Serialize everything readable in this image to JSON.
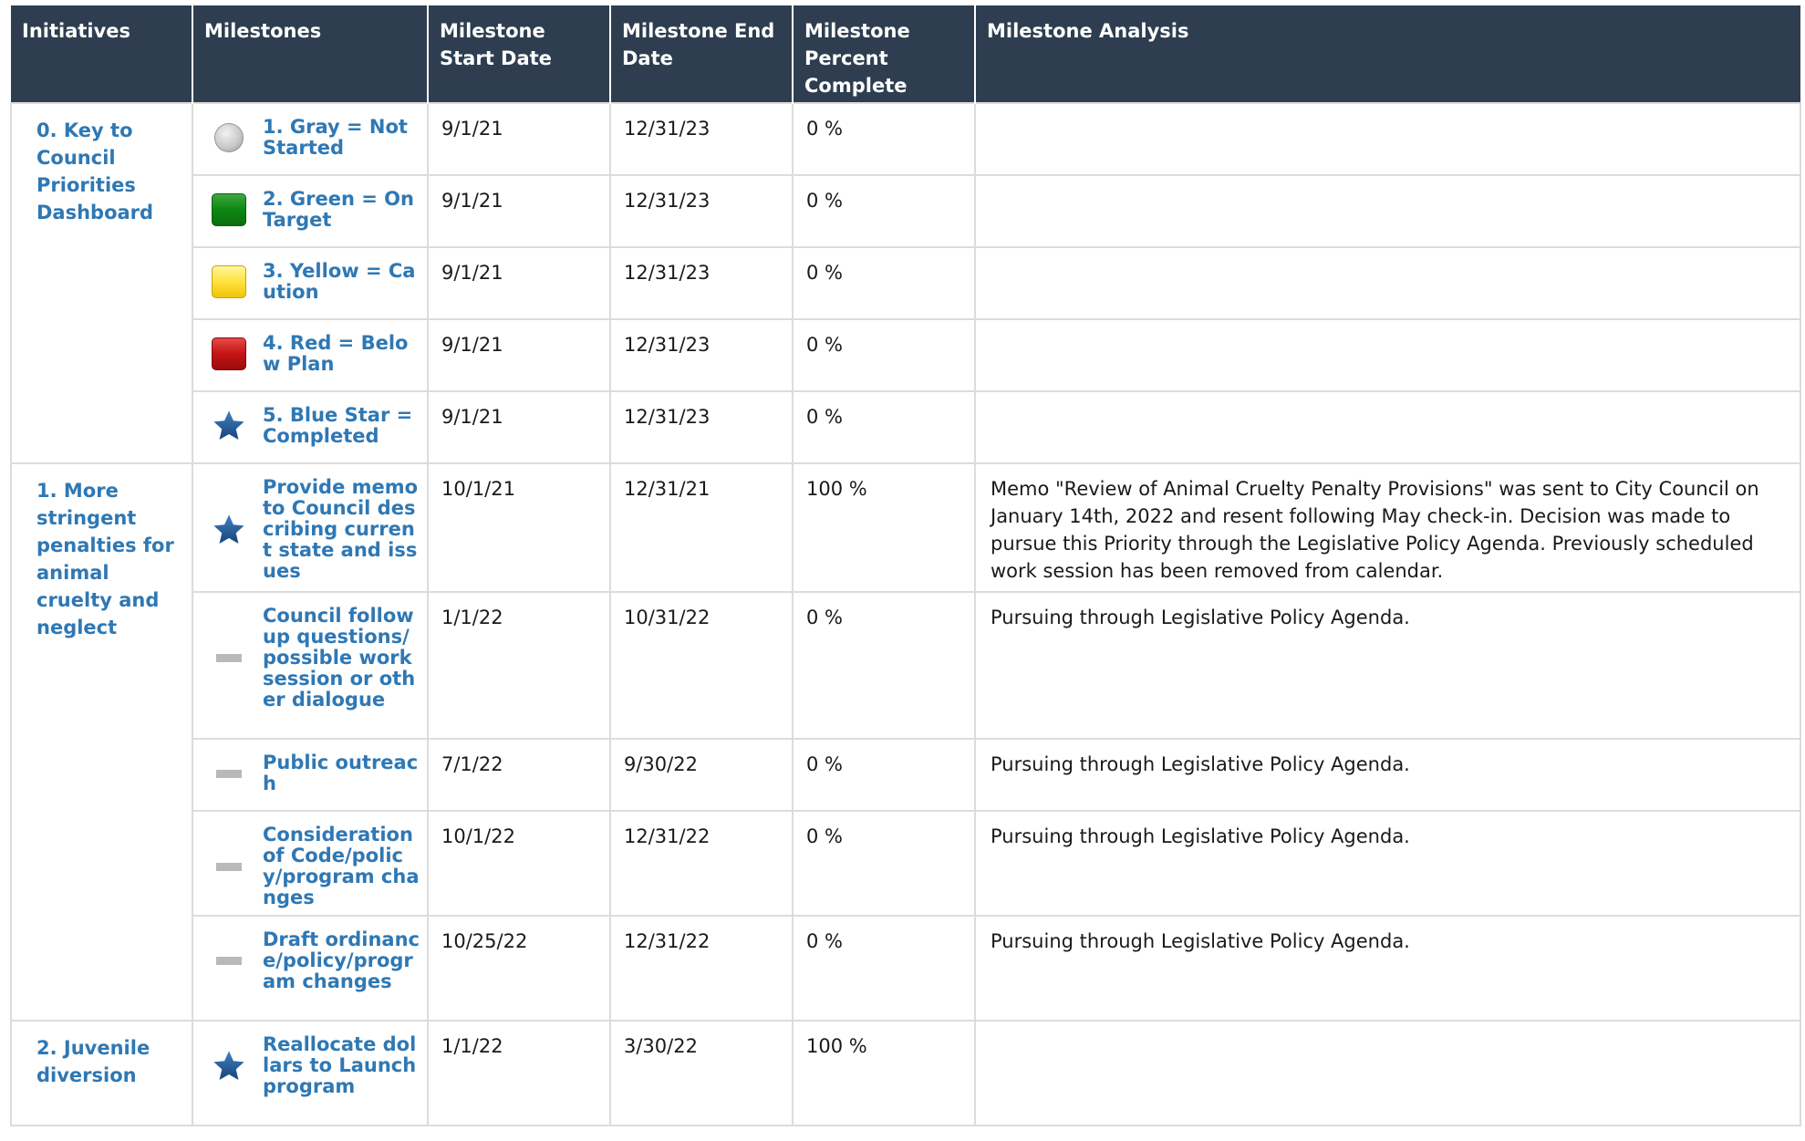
{
  "columns": {
    "initiatives": "Initiatives",
    "milestones": "Milestones",
    "start_date": "Milestone Start Date",
    "end_date": "Milestone End Date",
    "percent": "Milestone Percent Complete",
    "analysis": "Milestone Analysis"
  },
  "status_colors": {
    "link": "#2f78b4",
    "header_bg": "#2e3e50",
    "star": "#1f5d9e"
  },
  "groups": [
    {
      "initiative": "0. Key to Council Priorities Dashboard",
      "rows": [
        {
          "icon": "gray-circle-icon",
          "milestone": "1. Gray = Not Started",
          "start": "9/1/21",
          "end": "12/31/23",
          "percent": "0 %",
          "analysis": ""
        },
        {
          "icon": "green-square-icon",
          "milestone": "2. Green = On Target",
          "start": "9/1/21",
          "end": "12/31/23",
          "percent": "0 %",
          "analysis": ""
        },
        {
          "icon": "yellow-square-icon",
          "milestone": "3. Yellow = Caution",
          "start": "9/1/21",
          "end": "12/31/23",
          "percent": "0 %",
          "analysis": ""
        },
        {
          "icon": "red-square-icon",
          "milestone": "4. Red = Below Plan",
          "start": "9/1/21",
          "end": "12/31/23",
          "percent": "0 %",
          "analysis": ""
        },
        {
          "icon": "blue-star-icon",
          "milestone": "5. Blue Star = Completed",
          "start": "9/1/21",
          "end": "12/31/23",
          "percent": "0 %",
          "analysis": ""
        }
      ]
    },
    {
      "initiative": "1. More stringent penalties for animal cruelty and neglect",
      "rows": [
        {
          "icon": "blue-star-icon",
          "milestone": "Provide memo to Council describing current state and issues",
          "start": "10/1/21",
          "end": "12/31/21",
          "percent": "100 %",
          "analysis": "Memo \"Review of Animal Cruelty Penalty Provisions\" was sent to City Council on January 14th, 2022 and resent following May check-in. Decision was made to pursue this Priority through the Legislative Policy Agenda.  Previously scheduled work session has been removed from calendar."
        },
        {
          "icon": "gray-dash-icon",
          "milestone": "Council follow up questions/possible work session or other dialogue",
          "start": "1/1/22",
          "end": "10/31/22",
          "percent": "0 %",
          "analysis": "Pursuing through Legislative Policy Agenda."
        },
        {
          "icon": "gray-dash-icon",
          "milestone": "Public outreach",
          "start": "7/1/22",
          "end": "9/30/22",
          "percent": "0 %",
          "analysis": "Pursuing through Legislative Policy Agenda."
        },
        {
          "icon": "gray-dash-icon",
          "milestone": "Consideration of Code/policy/program changes",
          "start": "10/1/22",
          "end": "12/31/22",
          "percent": "0 %",
          "analysis": "Pursuing through Legislative Policy Agenda."
        },
        {
          "icon": "gray-dash-icon",
          "milestone": "Draft ordinance/policy/program changes",
          "start": "10/25/22",
          "end": "12/31/22",
          "percent": "0 %",
          "analysis": "Pursuing through Legislative Policy Agenda."
        }
      ]
    },
    {
      "initiative": "2. Juvenile diversion",
      "rows": [
        {
          "icon": "blue-star-icon",
          "milestone": "Reallocate dollars to Launch program",
          "start": "1/1/22",
          "end": "3/30/22",
          "percent": "100 %",
          "analysis": ""
        }
      ]
    }
  ]
}
